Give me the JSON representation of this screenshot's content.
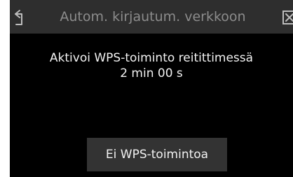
{
  "header": {
    "back_icon": "back-arrow-icon",
    "title": "Autom. kirjautum. verkkoon",
    "close_icon": "close-icon"
  },
  "main": {
    "instruction": "Aktivoi WPS-toiminto reitittimessä",
    "countdown": "2 min 00 s"
  },
  "actions": {
    "no_wps_label": "Ei WPS-toimintoa"
  },
  "colors": {
    "screen_background": "#000000",
    "title_bar_background": "#2e2e2e",
    "title_text": "#8c8c8c",
    "body_text": "#f2f2f2",
    "button_background": "#333333"
  }
}
